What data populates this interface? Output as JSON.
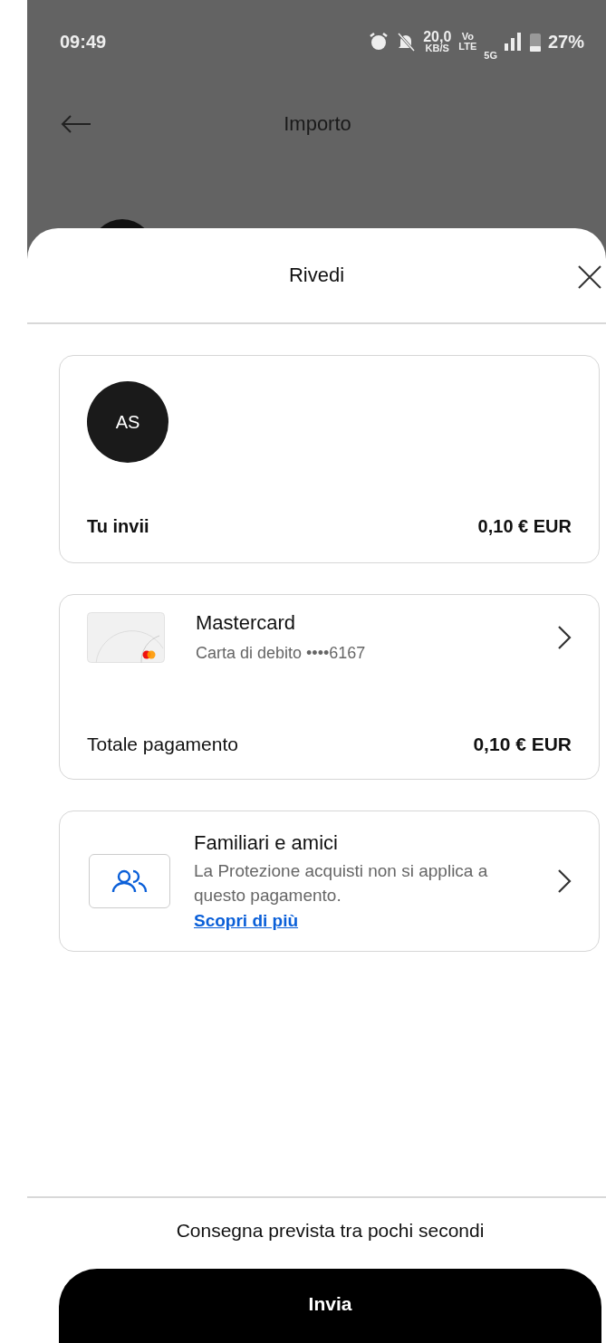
{
  "status_bar": {
    "time": "09:49",
    "speed": "20,0",
    "speed_unit": "KB/S",
    "volte_top": "Vo",
    "volte_bottom": "LTE",
    "network": "5G",
    "battery": "27%"
  },
  "header": {
    "title": "Importo"
  },
  "sheet": {
    "title": "Rivedi",
    "recipient": {
      "initials": "AS",
      "label": "Tu invii",
      "amount": "0,10 € EUR"
    },
    "payment": {
      "name": "Mastercard",
      "detail": "Carta di debito ••••6167",
      "label": "Totale pagamento",
      "amount": "0,10 € EUR"
    },
    "protection": {
      "title": "Familiari e amici",
      "text": "La Protezione acquisti non si applica a questo pagamento.",
      "link": "Scopri di più"
    },
    "delivery_note": "Consegna prevista tra pochi secondi",
    "button": "Invia"
  }
}
